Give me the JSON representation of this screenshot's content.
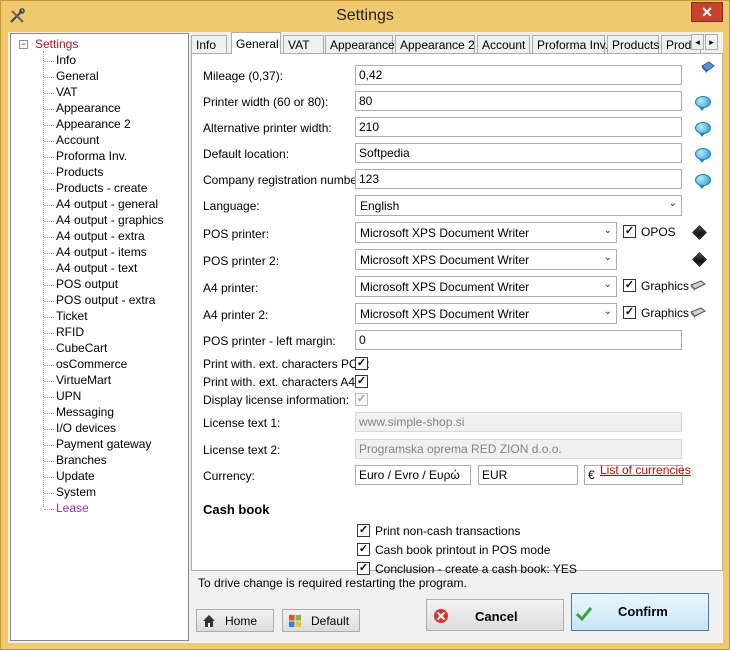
{
  "window": {
    "title": "Settings",
    "close_label": "✕"
  },
  "tree": {
    "root": {
      "expander": "−",
      "label": "Settings"
    },
    "items": [
      "Info",
      "General",
      "VAT",
      "Appearance",
      "Appearance 2",
      "Account",
      "Proforma Inv.",
      "Products",
      "Products - create",
      "A4 output - general",
      "A4 output - graphics",
      "A4 output - extra",
      "A4 output - items",
      "A4 output - text",
      "POS output",
      "POS output - extra",
      "Ticket",
      "RFID",
      "CubeCart",
      "osCommerce",
      "VirtueMart",
      "UPN",
      "Messaging",
      "I/O devices",
      "Payment gateway",
      "Branches",
      "Update",
      "System",
      "Lease"
    ],
    "active_item": "Lease"
  },
  "tabs": {
    "items": [
      "Info",
      "General",
      "VAT",
      "Appearance",
      "Appearance 2",
      "Account",
      "Proforma Inv.",
      "Products",
      "Produc"
    ],
    "active": "General",
    "scroll_left": "◂",
    "scroll_right": "▸"
  },
  "general": {
    "mileage_label": "Mileage (0,37):",
    "mileage_value": "0,42",
    "printer_width_label": "Printer width (60 or 80):",
    "printer_width_value": "80",
    "alt_printer_width_label": "Alternative printer width:",
    "alt_printer_width_value": "210",
    "default_location_label": "Default location:",
    "default_location_value": "Softpedia",
    "company_reg_label": "Company registration number:",
    "company_reg_value": "123",
    "language_label": "Language:",
    "language_value": "English",
    "pos_printer_label": "POS printer:",
    "pos_printer_value": "Microsoft XPS Document Writer",
    "pos_printer_opt_label": "OPOS",
    "pos_printer2_label": "POS printer 2:",
    "pos_printer2_value": "Microsoft XPS Document Writer",
    "a4_printer_label": "A4 printer:",
    "a4_printer_value": "Microsoft XPS Document Writer",
    "a4_printer_opt_label": "Graphics",
    "a4_printer2_label": "A4 printer 2:",
    "a4_printer2_value": "Microsoft XPS Document Writer",
    "a4_printer2_opt_label": "Graphics",
    "pos_margin_label": "POS printer - left margin:",
    "pos_margin_value": "0",
    "print_ext_pos_label": "Print with. ext. characters POS:",
    "print_ext_a4_label": "Print with. ext. characters A4:",
    "display_license_label": "Display license information:",
    "license1_label": "License text 1:",
    "license1_value": "www.simple-shop.si",
    "license2_label": "License text 2:",
    "license2_value": "Programska oprema RED ZION d.o.o.",
    "currency_label": "Currency:",
    "currency_name": "Euro / Evro / Ευρώ",
    "currency_code": "EUR",
    "currency_symbol": "€",
    "currency_link": "List of currencies",
    "checkmark": "✓",
    "combo_arrow": "⌄"
  },
  "cashbook": {
    "title": "Cash book",
    "opt1": "Print non-cash transactions",
    "opt2": "Cash book printout in POS mode",
    "opt3": "Conclusion - create a cash book: YES"
  },
  "status_text": "To drive change is required restarting the program.",
  "buttons": {
    "home": "Home",
    "default": "Default",
    "cancel": "Cancel",
    "confirm": "Confirm"
  }
}
